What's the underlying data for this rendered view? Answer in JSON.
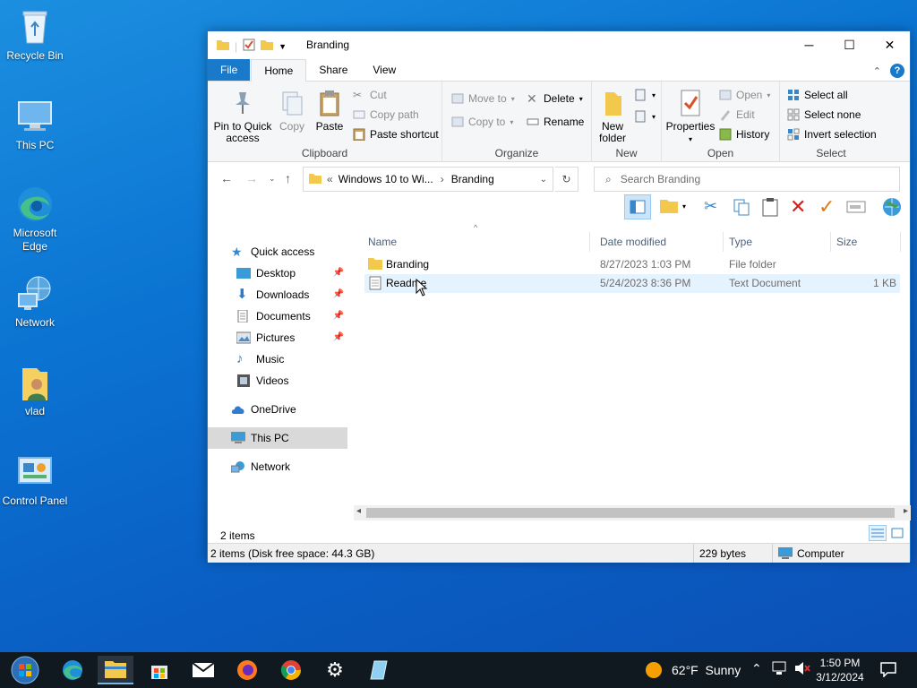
{
  "desktop": {
    "icons": [
      {
        "label": "Recycle Bin"
      },
      {
        "label": "This PC"
      },
      {
        "label": "Microsoft Edge"
      },
      {
        "label": "Network"
      },
      {
        "label": "vlad"
      },
      {
        "label": "Control Panel"
      }
    ]
  },
  "window": {
    "title": "Branding",
    "tabs": {
      "file": "File",
      "home": "Home",
      "share": "Share",
      "view": "View"
    },
    "ribbon": {
      "clipboard": {
        "label": "Clipboard",
        "pin": "Pin to Quick access",
        "copy": "Copy",
        "paste": "Paste",
        "cut": "Cut",
        "copy_path": "Copy path",
        "paste_shortcut": "Paste shortcut"
      },
      "organize": {
        "label": "Organize",
        "move_to": "Move to",
        "copy_to": "Copy to",
        "delete": "Delete",
        "rename": "Rename"
      },
      "new": {
        "label": "New",
        "new_folder": "New folder"
      },
      "open": {
        "label": "Open",
        "properties": "Properties",
        "open": "Open",
        "edit": "Edit",
        "history": "History"
      },
      "select": {
        "label": "Select",
        "select_all": "Select all",
        "select_none": "Select none",
        "invert": "Invert selection"
      }
    },
    "address": {
      "prefix": "«",
      "crumb1": "Windows 10 to Wi...",
      "sep": "›",
      "crumb2": "Branding"
    },
    "search": {
      "placeholder": "Search Branding"
    },
    "nav": [
      {
        "label": "Quick access"
      },
      {
        "label": "Desktop"
      },
      {
        "label": "Downloads"
      },
      {
        "label": "Documents"
      },
      {
        "label": "Pictures"
      },
      {
        "label": "Music"
      },
      {
        "label": "Videos"
      },
      {
        "label": "OneDrive"
      },
      {
        "label": "This PC"
      },
      {
        "label": "Network"
      }
    ],
    "columns": {
      "name": "Name",
      "date": "Date modified",
      "type": "Type",
      "size": "Size"
    },
    "files": [
      {
        "name": "Branding",
        "date": "8/27/2023 1:03 PM",
        "type": "File folder",
        "size": ""
      },
      {
        "name": "Readme",
        "date": "5/24/2023 8:36 PM",
        "type": "Text Document",
        "size": "1 KB"
      }
    ],
    "item_count": "2 items",
    "status": {
      "left": "2 items (Disk free space: 44.3 GB)",
      "size": "229 bytes",
      "location": "Computer"
    }
  },
  "taskbar": {
    "weather": "62°F  Sunny",
    "time": "1:50 PM",
    "date": "3/12/2024"
  },
  "colors": {
    "accent": "#1979ca",
    "folder": "#f2c94c",
    "hover_row": "#e5f3ff"
  }
}
